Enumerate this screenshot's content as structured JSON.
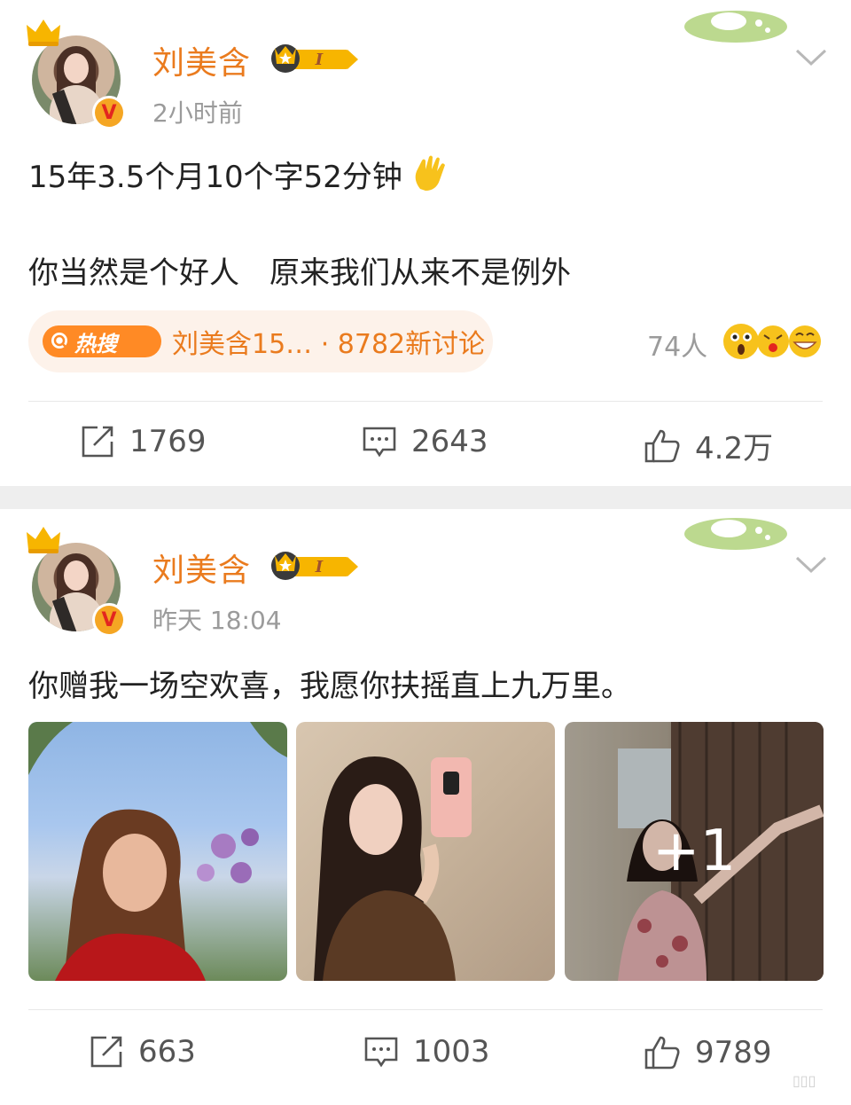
{
  "posts": [
    {
      "username": "刘美含",
      "vip_level": "I",
      "time": "2小时前",
      "content_line1": "15年3.5个月10个字52分钟",
      "content_line2": "你当然是个好人　原来我们从来不是例外",
      "hot_search": {
        "badge": "热搜",
        "label": "刘美含15… · 8782新讨论"
      },
      "reaction_count": "74人",
      "actions": {
        "repost": "1769",
        "comment": "2643",
        "like": "4.2万"
      }
    },
    {
      "username": "刘美含",
      "vip_level": "I",
      "time": "昨天 18:04",
      "content_line1": "你赠我一场空欢喜，我愿你扶摇直上九万里。",
      "photos_more": "+1",
      "actions": {
        "repost": "663",
        "comment": "1003",
        "like": "9789"
      }
    }
  ],
  "icons": {
    "repost": "repost-icon",
    "comment": "comment-icon",
    "like": "like-icon",
    "more": "chevron-down-icon",
    "verified": "verified-v-icon",
    "crown": "crown-icon"
  },
  "colors": {
    "username": "#ea7b1e",
    "hot_badge": "#ff8a25",
    "hot_pill_bg": "#fdf2ea",
    "secondary_text": "#9b9b9b"
  }
}
